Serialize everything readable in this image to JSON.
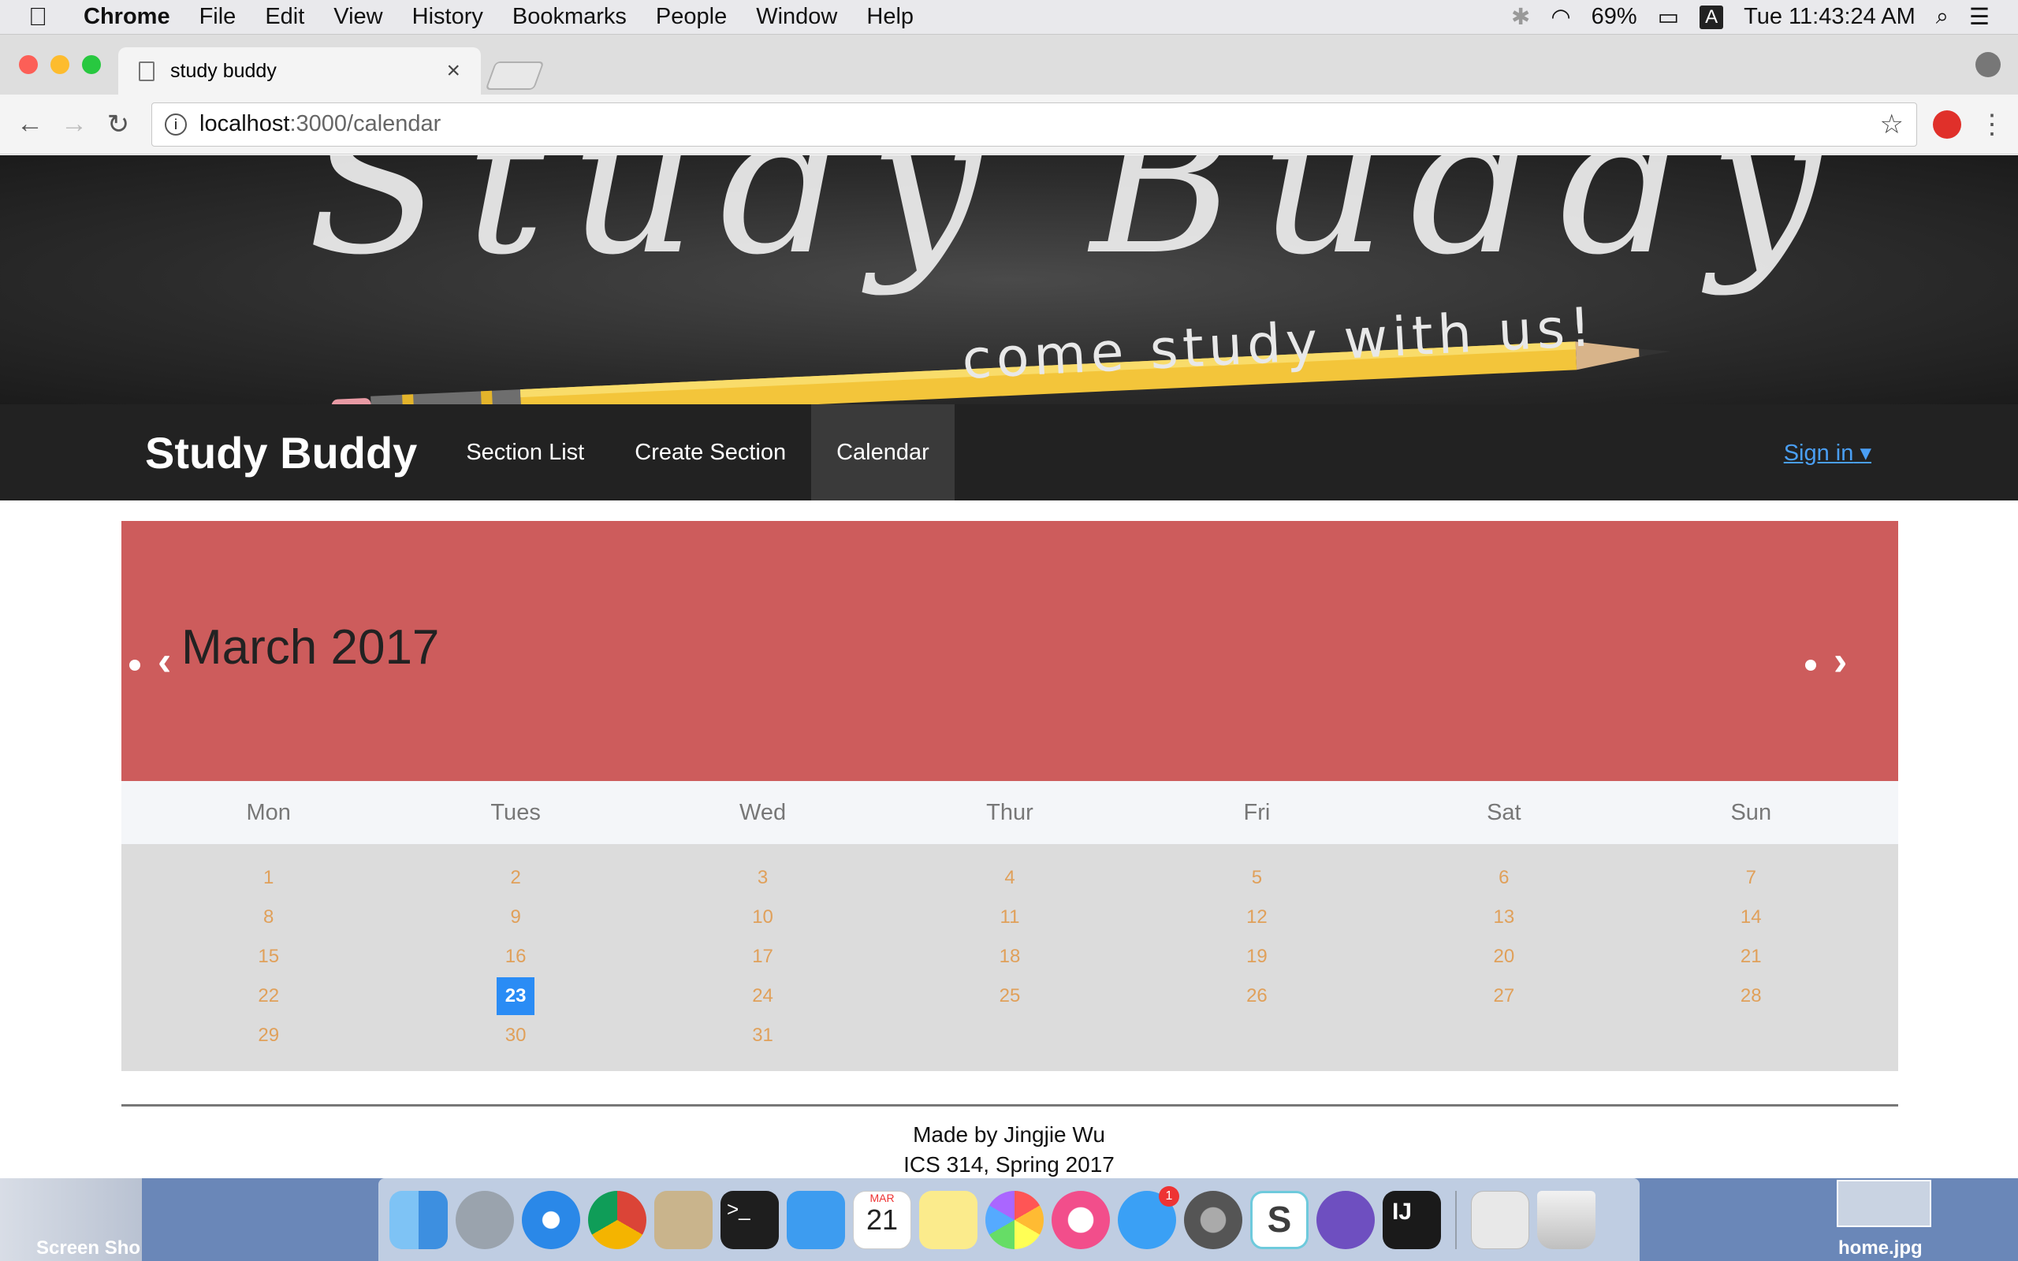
{
  "menubar": {
    "app": "Chrome",
    "menus": [
      "File",
      "Edit",
      "View",
      "History",
      "Bookmarks",
      "People",
      "Window",
      "Help"
    ],
    "battery": "69%",
    "input_source": "A",
    "clock": "Tue 11:43:24 AM"
  },
  "browser": {
    "tab_title": "study buddy",
    "url_host": "localhost",
    "url_path": ":3000/calendar"
  },
  "banner": {
    "title": "Study Buddy",
    "tagline": "come study with us!"
  },
  "navbar": {
    "brand": "Study Buddy",
    "links": [
      "Section List",
      "Create Section",
      "Calendar"
    ],
    "active_link": "Calendar",
    "signin": "Sign in"
  },
  "calendar": {
    "month_title": "March 2017",
    "prev": "‹",
    "next": "›",
    "weekdays": [
      "Mon",
      "Tues",
      "Wed",
      "Thur",
      "Fri",
      "Sat",
      "Sun"
    ],
    "weeks": [
      [
        "1",
        "2",
        "3",
        "4",
        "5",
        "6",
        "7"
      ],
      [
        "8",
        "9",
        "10",
        "11",
        "12",
        "13",
        "14"
      ],
      [
        "15",
        "16",
        "17",
        "18",
        "19",
        "20",
        "21"
      ],
      [
        "22",
        "23",
        "24",
        "25",
        "26",
        "27",
        "28"
      ],
      [
        "29",
        "30",
        "31",
        "",
        "",
        "",
        ""
      ]
    ],
    "today": "23",
    "colors": {
      "header": "#cd5c5c",
      "day_text": "#e0a05a",
      "today_bg": "#2a8cf5"
    }
  },
  "footer": {
    "line1": "Made by Jingjie Wu",
    "line2": "ICS 314, Spring 2017"
  },
  "desktop": {
    "left_label": "Screen Sho",
    "right_label": "home.jpg",
    "dock_badge": "1",
    "calendar_month": "MAR",
    "calendar_day": "21"
  }
}
